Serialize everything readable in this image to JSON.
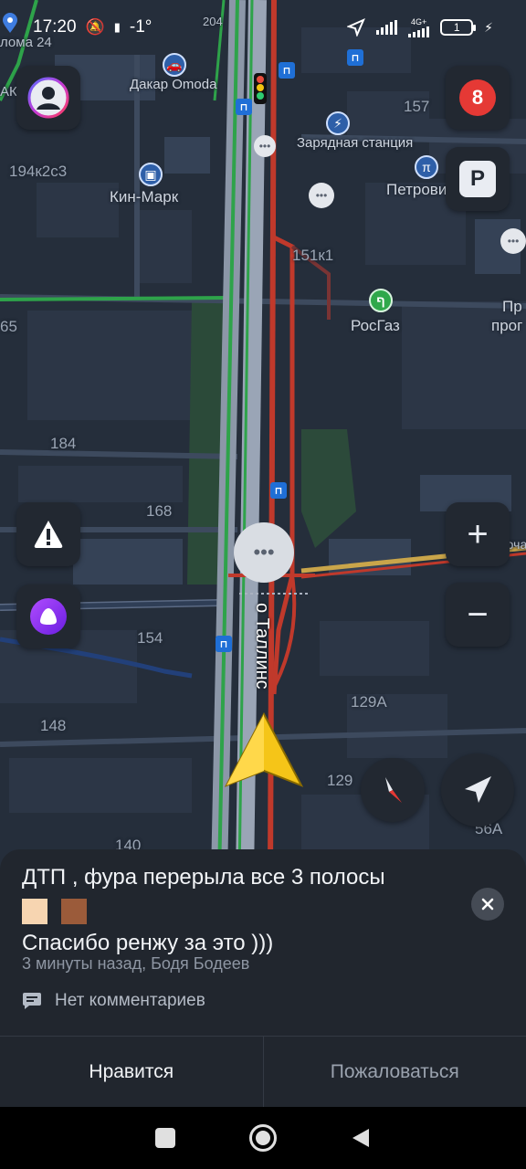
{
  "status": {
    "time": "17:20",
    "temperature": "-1°",
    "network": "4G+",
    "battery": "1"
  },
  "map": {
    "street_labels": [
      "лома 24",
      "204",
      "157",
      "194к2с3",
      "151к1",
      "65",
      "184",
      "168",
      "154",
      "148",
      "129А",
      "129",
      "140",
      "56А",
      "АК"
    ],
    "poi_labels": [
      "Дакар Omoda",
      "Зарядная станция",
      "Кин-Марк",
      "Петрови",
      "РосГаз",
      "Пр",
      "прог",
      "Рабоча"
    ],
    "road_name": "о Таллинс",
    "traffic_level": "8"
  },
  "buttons": {
    "profile": "profile",
    "traffic": "8",
    "parking": "P",
    "zoom_in": "+",
    "zoom_out": "−"
  },
  "event": {
    "text_line1": "ДТП , фура перерыла все 3 полосы",
    "text_line2": "Спасибо ренжу за это )))",
    "meta": "3 минуты назад, Бодя Бодеев",
    "comments": "Нет комментариев",
    "like_label": "Нравится",
    "report_label": "Пожаловаться"
  },
  "colors": {
    "map_bg": "#252e3b",
    "road_red": "#c0392b",
    "road_green": "#2ea34a",
    "accent_yellow": "#f5c518",
    "sheet_bg": "#21262e"
  }
}
